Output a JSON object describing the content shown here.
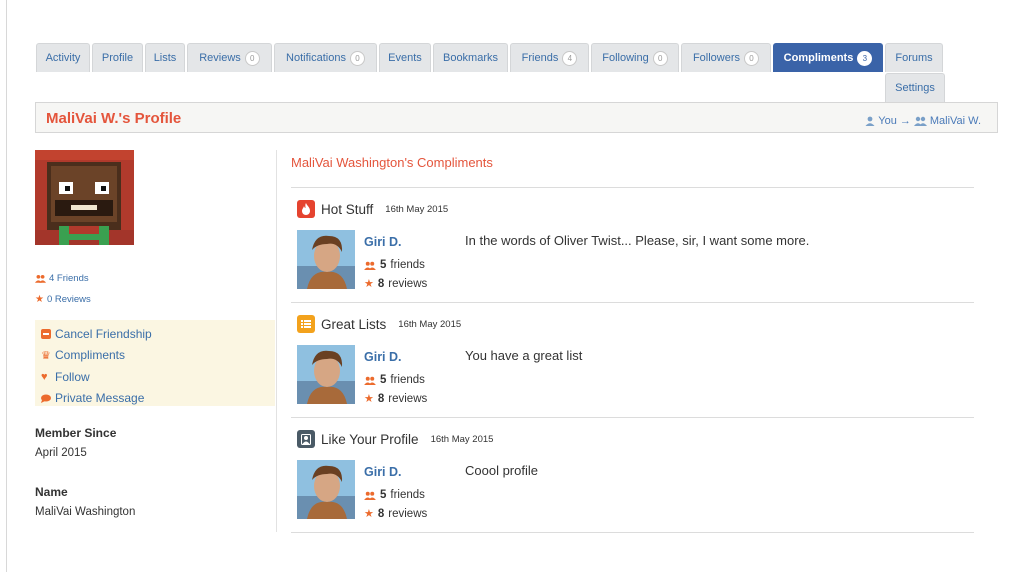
{
  "tabs": [
    {
      "label": "Activity",
      "badge": null,
      "active": false
    },
    {
      "label": "Profile",
      "badge": null,
      "active": false
    },
    {
      "label": "Lists",
      "badge": null,
      "active": false
    },
    {
      "label": "Reviews",
      "badge": "0",
      "active": false
    },
    {
      "label": "Notifications",
      "badge": "0",
      "active": false
    },
    {
      "label": "Events",
      "badge": null,
      "active": false
    },
    {
      "label": "Bookmarks",
      "badge": null,
      "active": false
    },
    {
      "label": "Friends",
      "badge": "4",
      "active": false
    },
    {
      "label": "Following",
      "badge": "0",
      "active": false
    },
    {
      "label": "Followers",
      "badge": "0",
      "active": false
    },
    {
      "label": "Compliments",
      "badge": "3",
      "active": true
    },
    {
      "label": "Forums",
      "badge": null,
      "active": false
    },
    {
      "label": "Settings",
      "badge": null,
      "active": false
    }
  ],
  "header": {
    "title": "MaliVai W.'s Profile",
    "crumb_you": "You",
    "crumb_arrow": "→",
    "crumb_user": "MaliVai W."
  },
  "sidebar": {
    "friends_link": "4 Friends",
    "reviews_link": "0 Reviews",
    "actions": [
      {
        "label": "Cancel Friendship",
        "icon": "minus-icon",
        "color": "#ec6b2d"
      },
      {
        "label": "Compliments",
        "icon": "trophy-icon",
        "color": "#ec6b2d"
      },
      {
        "label": "Follow",
        "icon": "heart-icon",
        "color": "#ec6b2d"
      },
      {
        "label": "Private Message",
        "icon": "comment-icon",
        "color": "#ec6b2d"
      }
    ],
    "member_since_label": "Member Since",
    "member_since_value": "April 2015",
    "name_label": "Name",
    "name_value": "MaliVai Washington"
  },
  "main": {
    "title": "MaliVai Washington's Compliments",
    "compliments": [
      {
        "type": "Hot Stuff",
        "date": "16th May 2015",
        "icon": "flame-icon",
        "icon_color": "#e5432f",
        "user": "Giri D.",
        "friends": "5",
        "friends_label": "friends",
        "reviews": "8",
        "reviews_label": "reviews",
        "message": "In the words of Oliver Twist... Please, sir, I want some more."
      },
      {
        "type": "Great Lists",
        "date": "16th May 2015",
        "icon": "list-icon",
        "icon_color": "#f3a21c",
        "user": "Giri D.",
        "friends": "5",
        "friends_label": "friends",
        "reviews": "8",
        "reviews_label": "reviews",
        "message": "You have a great list"
      },
      {
        "type": "Like Your Profile",
        "date": "16th May 2015",
        "icon": "profile-icon",
        "icon_color": "#4a5a66",
        "user": "Giri D.",
        "friends": "5",
        "friends_label": "friends",
        "reviews": "8",
        "reviews_label": "reviews",
        "message": "Coool profile"
      }
    ]
  },
  "colors": {
    "accent": "#e4553c",
    "link": "#3a6ea8",
    "active_tab": "#3a63a8",
    "icon_orange": "#ec6b2d"
  }
}
